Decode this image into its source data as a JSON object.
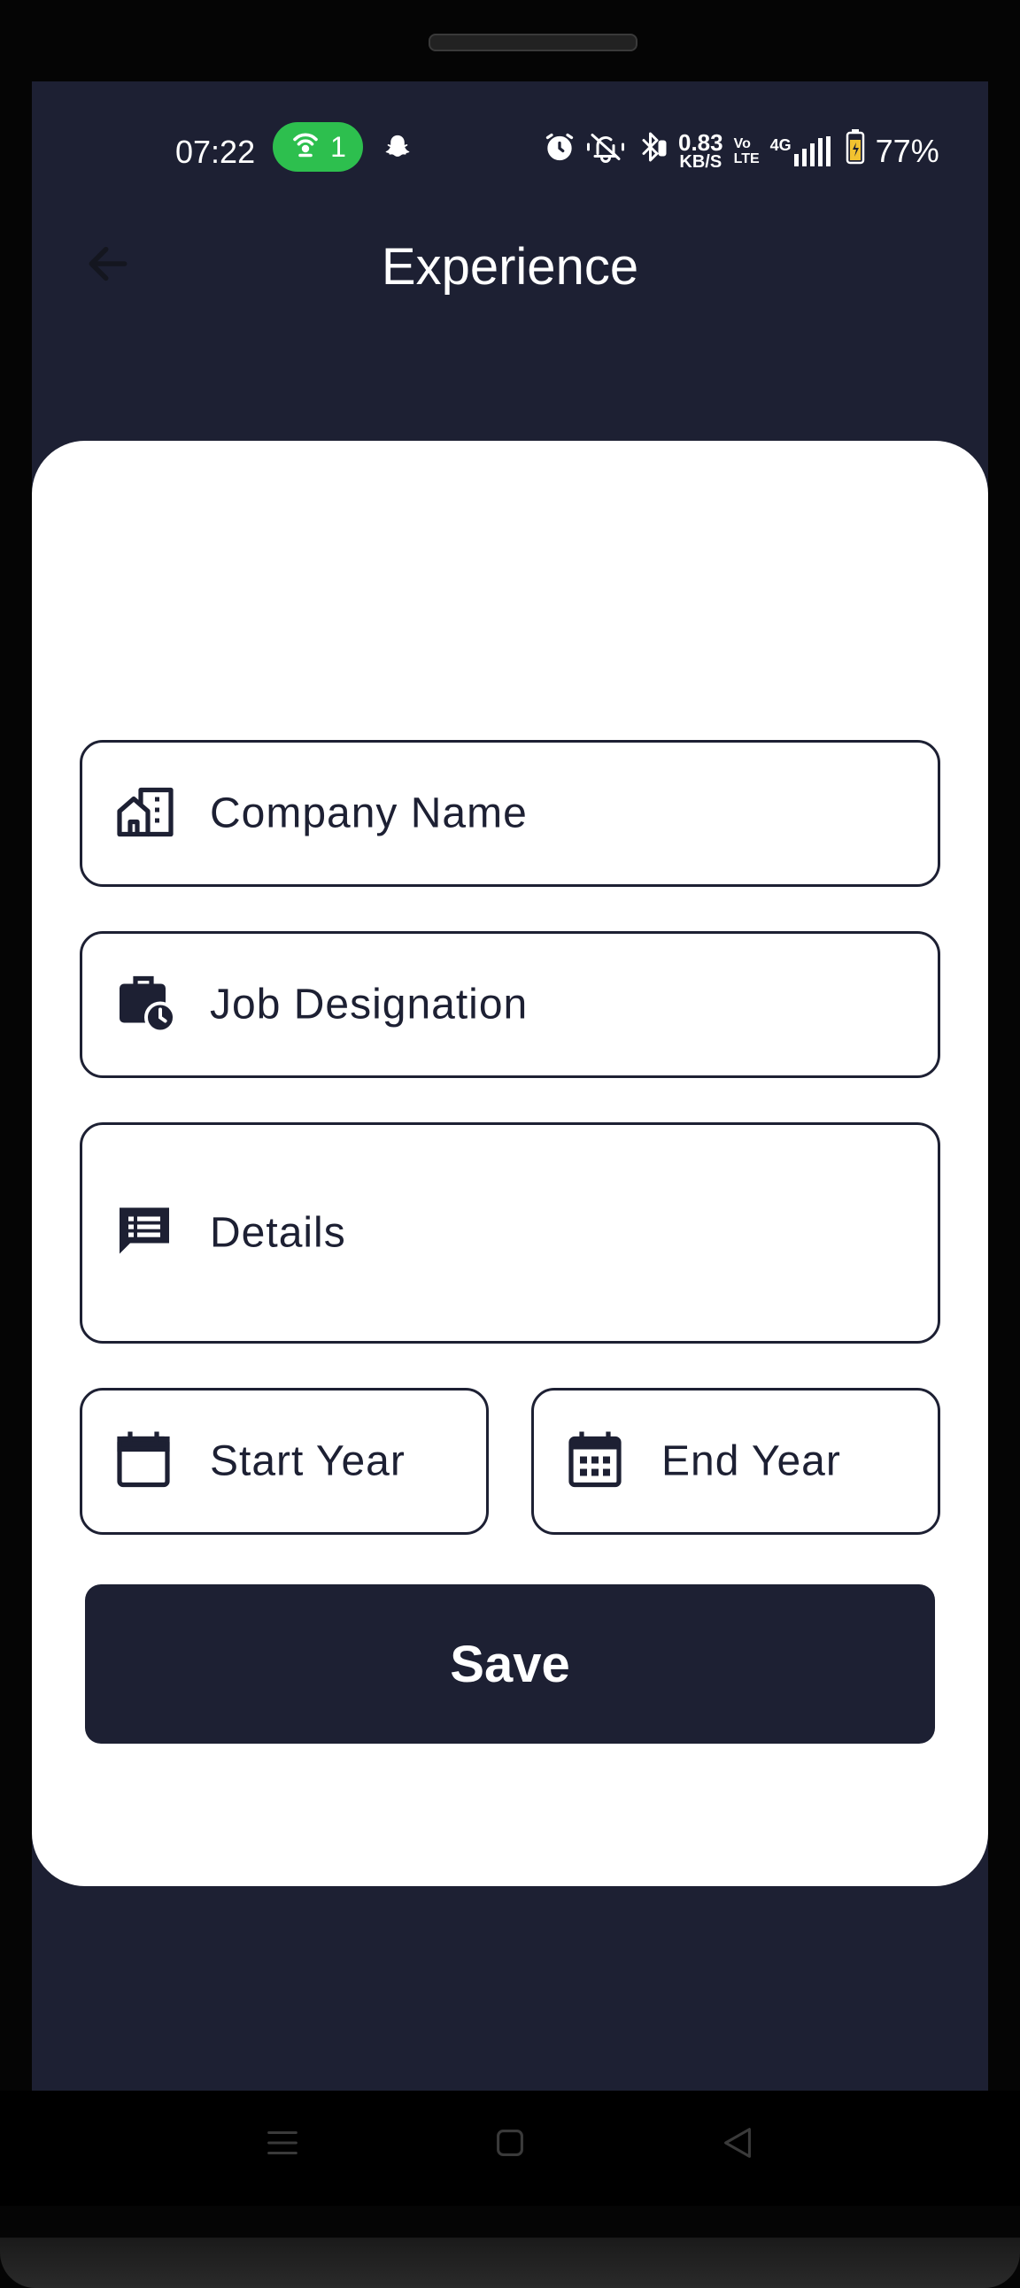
{
  "status_bar": {
    "time": "07:22",
    "hotspot_count": "1",
    "net_speed_value": "0.83",
    "net_speed_unit": "KB/S",
    "volte_top": "Vo",
    "volte_bottom": "LTE",
    "network_type": "4G",
    "battery": "77%"
  },
  "header": {
    "title": "Experience"
  },
  "form": {
    "company": {
      "label": "Company Name",
      "icon": "company-building-icon"
    },
    "designation": {
      "label": "Job Designation",
      "icon": "briefcase-clock-icon"
    },
    "details": {
      "label": "Details",
      "icon": "chat-list-icon"
    },
    "start_year": {
      "label": "Start Year",
      "icon": "calendar-blank-icon"
    },
    "end_year": {
      "label": "End Year",
      "icon": "calendar-grid-icon"
    },
    "save_label": "Save"
  },
  "colors": {
    "primary": "#1d2033",
    "background": "#1d2033",
    "card": "#ffffff",
    "hotspot": "#2dbf4e"
  }
}
